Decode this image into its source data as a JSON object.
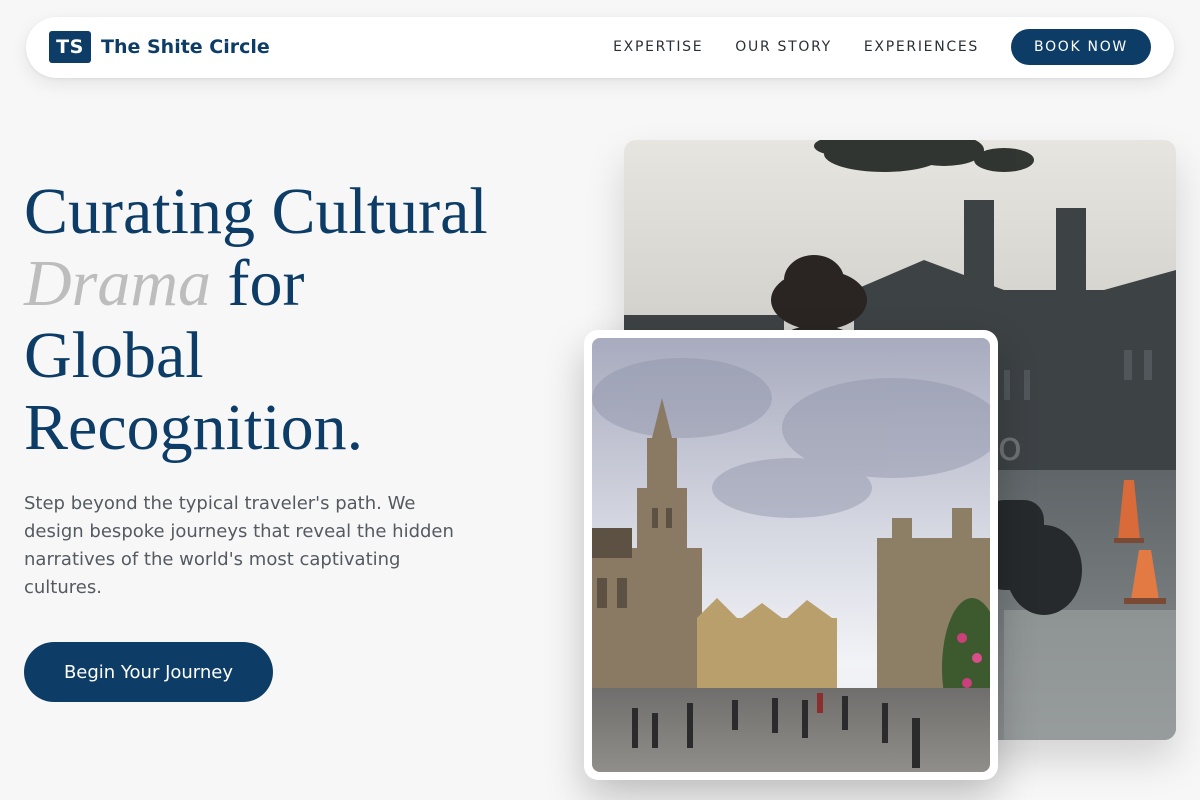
{
  "brand": {
    "logo_text": "TS",
    "name": "The Shite Circle"
  },
  "nav": {
    "links": [
      "EXPERTISE",
      "OUR STORY",
      "EXPERIENCES"
    ],
    "book_label": "BOOK NOW"
  },
  "hero": {
    "headline_line1": "Curating Cultural",
    "headline_accent": "Drama",
    "headline_line2_rest": " for",
    "headline_line3": "Global",
    "headline_line4": "Recognition.",
    "lead": "Step beyond the typical traveler's path. We design bespoke journeys that reveal the hidden narratives of the world's most captivating cultures.",
    "cta_label": "Begin Your Journey"
  },
  "colors": {
    "brand": "#0d3d66",
    "accent_text": "#bdbdbd",
    "background": "#f7f7f8"
  },
  "images": {
    "back": "city-street-woman-in-hat-photo",
    "front": "grand-place-square-photo"
  }
}
